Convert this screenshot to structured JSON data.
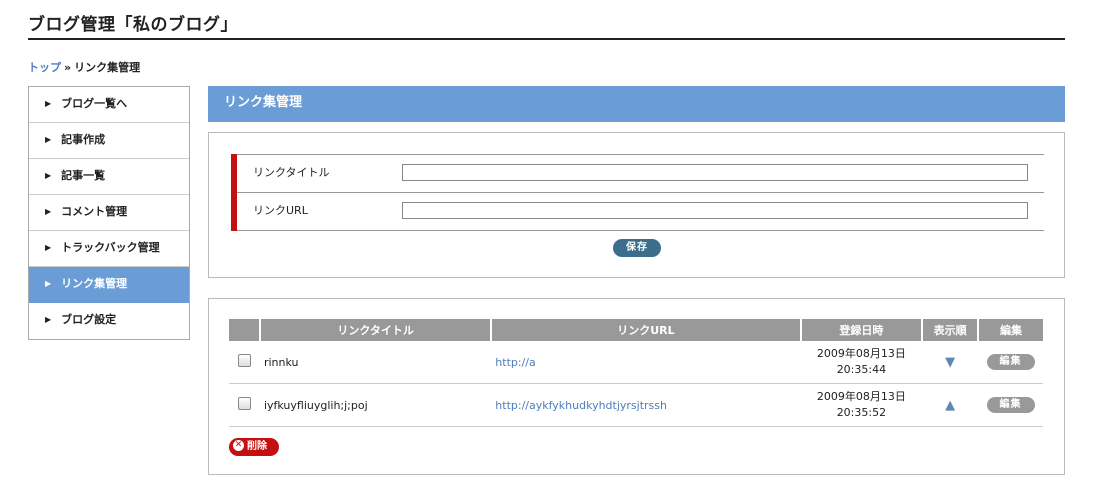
{
  "page": {
    "title": "ブログ管理「私のブログ」"
  },
  "breadcrumb": {
    "home": "トップ",
    "separator": "»",
    "current": "リンク集管理"
  },
  "sidebar": {
    "items": [
      {
        "label": "ブログ一覧へ"
      },
      {
        "label": "記事作成"
      },
      {
        "label": "記事一覧"
      },
      {
        "label": "コメント管理"
      },
      {
        "label": "トラックバック管理"
      },
      {
        "label": "リンク集管理"
      },
      {
        "label": "ブログ設定"
      }
    ],
    "arrow": "▶"
  },
  "main": {
    "header": "リンク集管理"
  },
  "form": {
    "title_label": "リンクタイトル",
    "title_value": "",
    "url_label": "リンクURL",
    "url_value": "",
    "save_label": "保存"
  },
  "table": {
    "headers": [
      "",
      "リンクタイトル",
      "リンクURL",
      "登録日時",
      "表示順",
      "編集"
    ],
    "rows": [
      {
        "title": "rinnku",
        "url": "http://a",
        "date": "2009年08月13日",
        "time": "20:35:44",
        "order_icon": "▼",
        "edit": "編集"
      },
      {
        "title": "iyfkuyfliuyglih;j;poj",
        "url": "http://aykfykhudkyhdtjyrsjtrssh",
        "date": "2009年08月13日",
        "time": "20:35:52",
        "order_icon": "▲",
        "edit": "編集"
      }
    ],
    "delete_label": "削除",
    "delete_icon": "✕"
  },
  "colors": {
    "accent": "#6a9dd6",
    "danger": "#c41010",
    "save": "#3b6e8a"
  }
}
